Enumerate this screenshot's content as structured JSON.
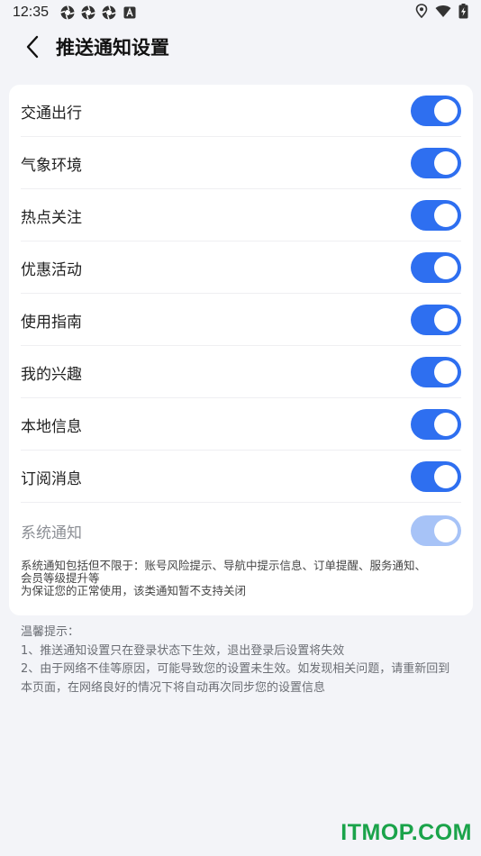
{
  "status_bar": {
    "time": "12:35",
    "left_icons": [
      "aperture-icon",
      "aperture-icon",
      "aperture-icon",
      "text-a-icon"
    ],
    "right_icons": [
      "location-icon",
      "wifi-icon",
      "battery-charging-icon"
    ]
  },
  "header": {
    "back_icon": "chevron-left-icon",
    "title": "推送通知设置"
  },
  "settings": [
    {
      "label": "交通出行",
      "enabled": true,
      "disabled": false
    },
    {
      "label": "气象环境",
      "enabled": true,
      "disabled": false
    },
    {
      "label": "热点关注",
      "enabled": true,
      "disabled": false
    },
    {
      "label": "优惠活动",
      "enabled": true,
      "disabled": false
    },
    {
      "label": "使用指南",
      "enabled": true,
      "disabled": false
    },
    {
      "label": "我的兴趣",
      "enabled": true,
      "disabled": false
    },
    {
      "label": "本地信息",
      "enabled": true,
      "disabled": false
    },
    {
      "label": "订阅消息",
      "enabled": true,
      "disabled": false
    },
    {
      "label": "系统通知",
      "enabled": true,
      "disabled": true
    }
  ],
  "system_note": {
    "line1": "系统通知包括但不限于：账号风险提示、导航中提示信息、订单提醒、服务通知、",
    "line2": "会员等级提升等",
    "line3": "为保证您的正常使用，该类通知暂不支持关闭"
  },
  "tips": {
    "title": "温馨提示：",
    "line1": "1、推送通知设置只在登录状态下生效，退出登录后设置将失效",
    "line2": "2、由于网络不佳等原因，可能导致您的设置未生效。如发现相关问题，请重新回到",
    "line3": "本页面，在网络良好的情况下将自动再次同步您的设置信息"
  },
  "watermark": "ITMOP.COM",
  "colors": {
    "toggle_on": "#2e6ff0",
    "toggle_disabled": "#a7c3f7",
    "background": "#f3f4f8",
    "watermark": "#1aa34a"
  }
}
